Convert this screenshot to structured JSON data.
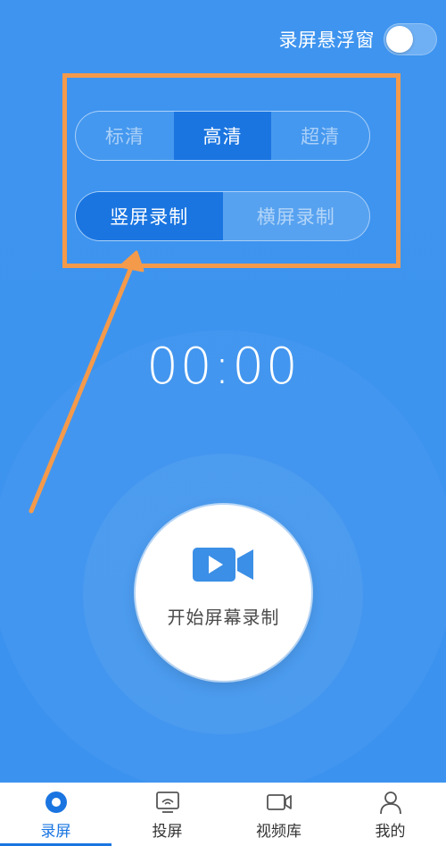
{
  "header": {
    "float_window_label": "录屏悬浮窗",
    "float_window_enabled": false
  },
  "quality": {
    "options": [
      "标清",
      "高清",
      "超清"
    ],
    "selected": "高清"
  },
  "orientation": {
    "options": [
      "竖屏录制",
      "横屏录制"
    ],
    "selected": "竖屏录制"
  },
  "timer": {
    "value": "00:00"
  },
  "record": {
    "label": "开始屏幕录制",
    "icon": "video-camera-icon"
  },
  "nav": {
    "items": [
      {
        "label": "录屏",
        "icon": "record-icon",
        "active": true
      },
      {
        "label": "投屏",
        "icon": "cast-icon",
        "active": false
      },
      {
        "label": "视频库",
        "icon": "video-library-icon",
        "active": false
      },
      {
        "label": "我的",
        "icon": "profile-icon",
        "active": false
      }
    ]
  },
  "colors": {
    "background": "#3e94ef",
    "accent": "#1a75e1",
    "annotation": "#f49a4b"
  }
}
